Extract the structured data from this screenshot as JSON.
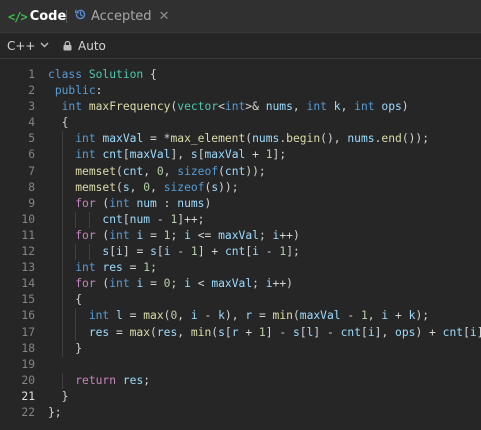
{
  "tabs": {
    "code_icon": "</>",
    "code_label": "Code",
    "accepted_label": "Accepted",
    "close_glyph": "✕"
  },
  "toolbar": {
    "language": "C++",
    "language_chevron": "⌄",
    "mode": "Auto"
  },
  "editor": {
    "active_line": 21,
    "lines": [
      [
        [
          "kw",
          "class"
        ],
        [
          "op",
          " "
        ],
        [
          "typ",
          "Solution"
        ],
        [
          "op",
          " {"
        ]
      ],
      [
        [
          "op",
          " "
        ],
        [
          "kw",
          "public"
        ],
        [
          "op",
          ":"
        ]
      ],
      [
        [
          "op",
          "  "
        ],
        [
          "kw",
          "int"
        ],
        [
          "op",
          " "
        ],
        [
          "fn",
          "maxFrequency"
        ],
        [
          "op",
          "("
        ],
        [
          "typ",
          "vector"
        ],
        [
          "op",
          "<"
        ],
        [
          "kw",
          "int"
        ],
        [
          "op",
          ">& "
        ],
        [
          "var",
          "nums"
        ],
        [
          "op",
          ", "
        ],
        [
          "kw",
          "int"
        ],
        [
          "op",
          " "
        ],
        [
          "var",
          "k"
        ],
        [
          "op",
          ", "
        ],
        [
          "kw",
          "int"
        ],
        [
          "op",
          " "
        ],
        [
          "var",
          "ops"
        ],
        [
          "op",
          ")"
        ]
      ],
      [
        [
          "op",
          "  {"
        ]
      ],
      [
        [
          "op",
          "    "
        ],
        [
          "kw",
          "int"
        ],
        [
          "op",
          " "
        ],
        [
          "var",
          "maxVal"
        ],
        [
          "op",
          " = *"
        ],
        [
          "fn",
          "max_element"
        ],
        [
          "op",
          "("
        ],
        [
          "var",
          "nums"
        ],
        [
          "op",
          "."
        ],
        [
          "fn",
          "begin"
        ],
        [
          "op",
          "(), "
        ],
        [
          "var",
          "nums"
        ],
        [
          "op",
          "."
        ],
        [
          "fn",
          "end"
        ],
        [
          "op",
          "());"
        ]
      ],
      [
        [
          "op",
          "    "
        ],
        [
          "kw",
          "int"
        ],
        [
          "op",
          " "
        ],
        [
          "var",
          "cnt"
        ],
        [
          "op",
          "["
        ],
        [
          "var",
          "maxVal"
        ],
        [
          "op",
          "], "
        ],
        [
          "var",
          "s"
        ],
        [
          "op",
          "["
        ],
        [
          "var",
          "maxVal"
        ],
        [
          "op",
          " + "
        ],
        [
          "num",
          "1"
        ],
        [
          "op",
          "];"
        ]
      ],
      [
        [
          "op",
          "    "
        ],
        [
          "fn",
          "memset"
        ],
        [
          "op",
          "("
        ],
        [
          "var",
          "cnt"
        ],
        [
          "op",
          ", "
        ],
        [
          "num",
          "0"
        ],
        [
          "op",
          ", "
        ],
        [
          "kw",
          "sizeof"
        ],
        [
          "op",
          "("
        ],
        [
          "var",
          "cnt"
        ],
        [
          "op",
          "));"
        ]
      ],
      [
        [
          "op",
          "    "
        ],
        [
          "fn",
          "memset"
        ],
        [
          "op",
          "("
        ],
        [
          "var",
          "s"
        ],
        [
          "op",
          ", "
        ],
        [
          "num",
          "0"
        ],
        [
          "op",
          ", "
        ],
        [
          "kw",
          "sizeof"
        ],
        [
          "op",
          "("
        ],
        [
          "var",
          "s"
        ],
        [
          "op",
          "));"
        ]
      ],
      [
        [
          "op",
          "    "
        ],
        [
          "kw2",
          "for"
        ],
        [
          "op",
          " ("
        ],
        [
          "kw",
          "int"
        ],
        [
          "op",
          " "
        ],
        [
          "var",
          "num"
        ],
        [
          "op",
          " : "
        ],
        [
          "var",
          "nums"
        ],
        [
          "op",
          ")"
        ]
      ],
      [
        [
          "op",
          "        "
        ],
        [
          "var",
          "cnt"
        ],
        [
          "op",
          "["
        ],
        [
          "var",
          "num"
        ],
        [
          "op",
          " - "
        ],
        [
          "num",
          "1"
        ],
        [
          "op",
          "]++;"
        ]
      ],
      [
        [
          "op",
          "    "
        ],
        [
          "kw2",
          "for"
        ],
        [
          "op",
          " ("
        ],
        [
          "kw",
          "int"
        ],
        [
          "op",
          " "
        ],
        [
          "var",
          "i"
        ],
        [
          "op",
          " = "
        ],
        [
          "num",
          "1"
        ],
        [
          "op",
          "; "
        ],
        [
          "var",
          "i"
        ],
        [
          "op",
          " <= "
        ],
        [
          "var",
          "maxVal"
        ],
        [
          "op",
          "; "
        ],
        [
          "var",
          "i"
        ],
        [
          "op",
          "++)"
        ]
      ],
      [
        [
          "op",
          "        "
        ],
        [
          "var",
          "s"
        ],
        [
          "op",
          "["
        ],
        [
          "var",
          "i"
        ],
        [
          "op",
          "] = "
        ],
        [
          "var",
          "s"
        ],
        [
          "op",
          "["
        ],
        [
          "var",
          "i"
        ],
        [
          "op",
          " - "
        ],
        [
          "num",
          "1"
        ],
        [
          "op",
          "] + "
        ],
        [
          "var",
          "cnt"
        ],
        [
          "op",
          "["
        ],
        [
          "var",
          "i"
        ],
        [
          "op",
          " - "
        ],
        [
          "num",
          "1"
        ],
        [
          "op",
          "];"
        ]
      ],
      [
        [
          "op",
          "    "
        ],
        [
          "kw",
          "int"
        ],
        [
          "op",
          " "
        ],
        [
          "var",
          "res"
        ],
        [
          "op",
          " = "
        ],
        [
          "num",
          "1"
        ],
        [
          "op",
          ";"
        ]
      ],
      [
        [
          "op",
          "    "
        ],
        [
          "kw2",
          "for"
        ],
        [
          "op",
          " ("
        ],
        [
          "kw",
          "int"
        ],
        [
          "op",
          " "
        ],
        [
          "var",
          "i"
        ],
        [
          "op",
          " = "
        ],
        [
          "num",
          "0"
        ],
        [
          "op",
          "; "
        ],
        [
          "var",
          "i"
        ],
        [
          "op",
          " < "
        ],
        [
          "var",
          "maxVal"
        ],
        [
          "op",
          "; "
        ],
        [
          "var",
          "i"
        ],
        [
          "op",
          "++)"
        ]
      ],
      [
        [
          "op",
          "    {"
        ]
      ],
      [
        [
          "op",
          "      "
        ],
        [
          "kw",
          "int"
        ],
        [
          "op",
          " "
        ],
        [
          "var",
          "l"
        ],
        [
          "op",
          " = "
        ],
        [
          "fn",
          "max"
        ],
        [
          "op",
          "("
        ],
        [
          "num",
          "0"
        ],
        [
          "op",
          ", "
        ],
        [
          "var",
          "i"
        ],
        [
          "op",
          " - "
        ],
        [
          "var",
          "k"
        ],
        [
          "op",
          "), "
        ],
        [
          "var",
          "r"
        ],
        [
          "op",
          " = "
        ],
        [
          "fn",
          "min"
        ],
        [
          "op",
          "("
        ],
        [
          "var",
          "maxVal"
        ],
        [
          "op",
          " - "
        ],
        [
          "num",
          "1"
        ],
        [
          "op",
          ", "
        ],
        [
          "var",
          "i"
        ],
        [
          "op",
          " + "
        ],
        [
          "var",
          "k"
        ],
        [
          "op",
          ");"
        ]
      ],
      [
        [
          "op",
          "      "
        ],
        [
          "var",
          "res"
        ],
        [
          "op",
          " = "
        ],
        [
          "fn",
          "max"
        ],
        [
          "op",
          "("
        ],
        [
          "var",
          "res"
        ],
        [
          "op",
          ", "
        ],
        [
          "fn",
          "min"
        ],
        [
          "op",
          "("
        ],
        [
          "var",
          "s"
        ],
        [
          "op",
          "["
        ],
        [
          "var",
          "r"
        ],
        [
          "op",
          " + "
        ],
        [
          "num",
          "1"
        ],
        [
          "op",
          "] - "
        ],
        [
          "var",
          "s"
        ],
        [
          "op",
          "["
        ],
        [
          "var",
          "l"
        ],
        [
          "op",
          "] - "
        ],
        [
          "var",
          "cnt"
        ],
        [
          "op",
          "["
        ],
        [
          "var",
          "i"
        ],
        [
          "op",
          "], "
        ],
        [
          "var",
          "ops"
        ],
        [
          "op",
          ") + "
        ],
        [
          "var",
          "cnt"
        ],
        [
          "op",
          "["
        ],
        [
          "var",
          "i"
        ],
        [
          "op",
          "]);"
        ]
      ],
      [
        [
          "op",
          "    }"
        ]
      ],
      [],
      [
        [
          "op",
          "    "
        ],
        [
          "kw2",
          "return"
        ],
        [
          "op",
          " "
        ],
        [
          "var",
          "res"
        ],
        [
          "op",
          ";"
        ]
      ],
      [
        [
          "op",
          "  }"
        ]
      ],
      [
        [
          "op",
          "};"
        ]
      ]
    ]
  },
  "colors": {
    "background": "#262626",
    "keyword": "#569cd6",
    "control_keyword": "#c586c0",
    "type": "#4ec9b0",
    "function": "#dcdcaa",
    "variable": "#9cdcfe",
    "number": "#b5cea8",
    "accepted_icon": "#3fb950"
  }
}
